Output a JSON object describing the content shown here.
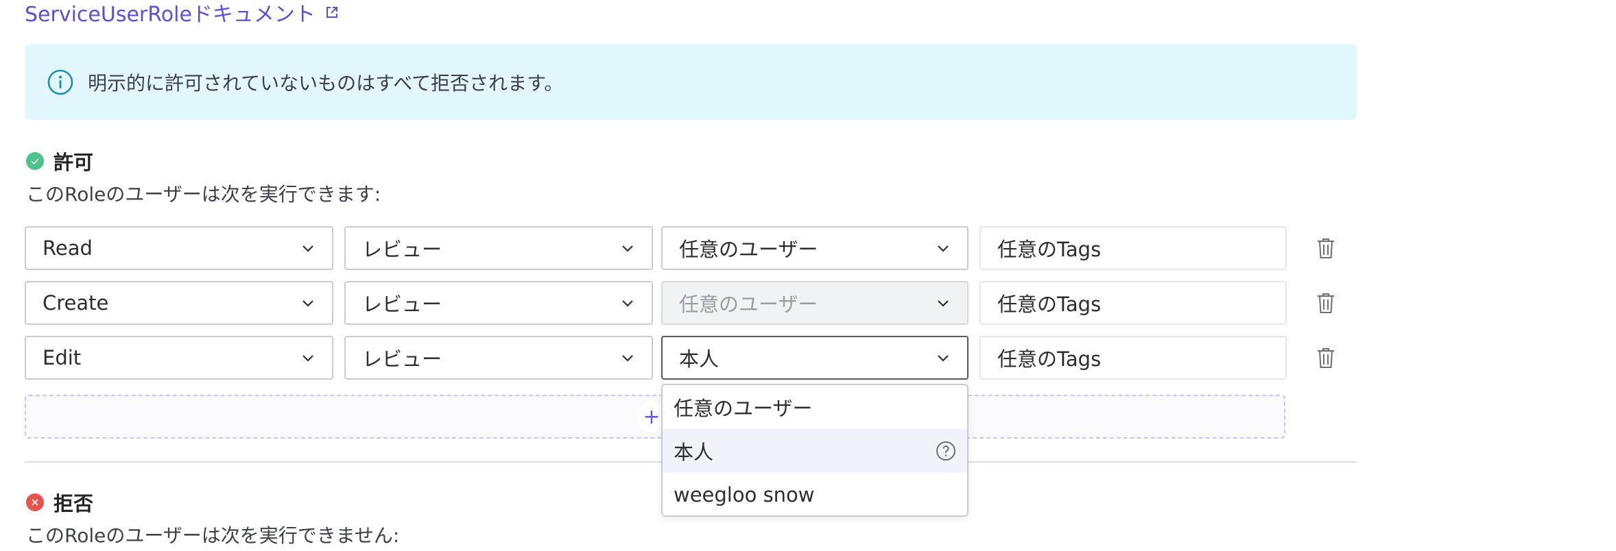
{
  "doc_link": {
    "label": "ServiceUserRoleドキュメント"
  },
  "notice": {
    "text": "明示的に許可されていないものはすべて拒否されます。"
  },
  "allow": {
    "title": "許可",
    "subtitle": "このRoleのユーザーは次を実行できます:",
    "rows": [
      {
        "action": "Read",
        "resource": "レビュー",
        "scope": "任意のユーザー",
        "tags": "任意のTags"
      },
      {
        "action": "Create",
        "resource": "レビュー",
        "scope": "任意のユーザー",
        "tags": "任意のTags"
      },
      {
        "action": "Edit",
        "resource": "レビュー",
        "scope": "本人",
        "tags": "任意のTags"
      }
    ],
    "add_symbol": "+"
  },
  "dropdown": {
    "options": [
      "任意のユーザー",
      "本人",
      "weegloo snow"
    ]
  },
  "deny": {
    "title": "拒否",
    "subtitle": "このRoleのユーザーは次を実行できません:"
  },
  "colors": {
    "link": "#5b4fd8",
    "notice_bg": "#e1f7fc",
    "allow_green": "#4cc38a",
    "deny_red": "#e5534b"
  }
}
